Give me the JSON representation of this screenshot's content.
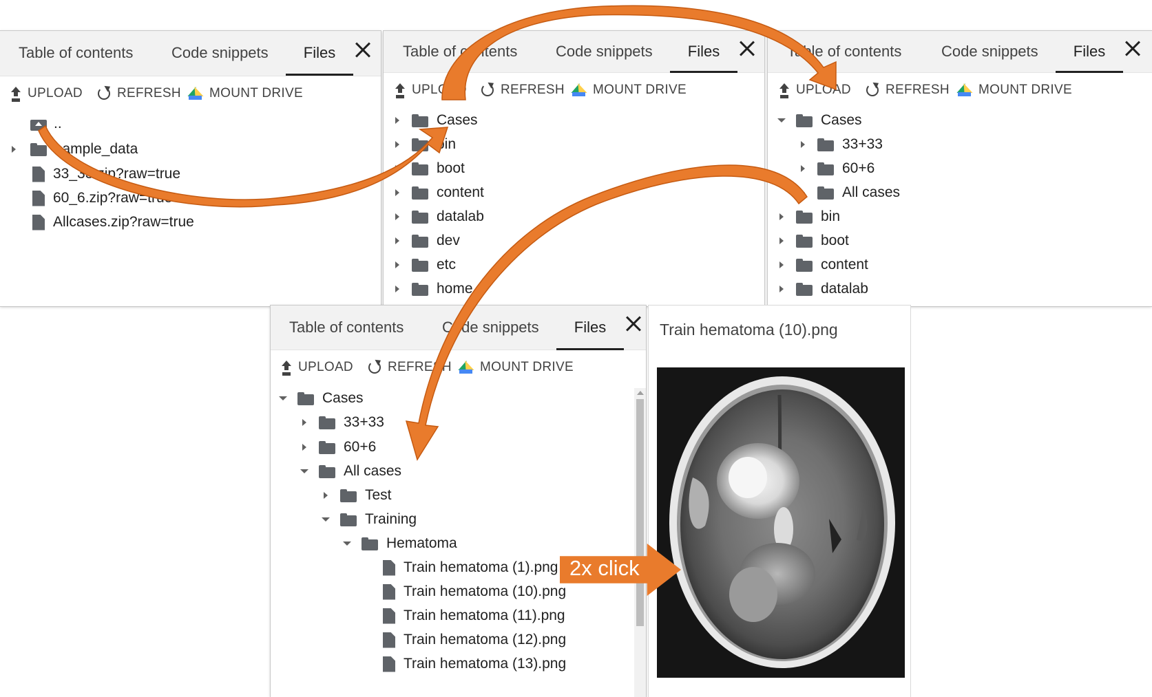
{
  "tabs": {
    "toc": "Table of contents",
    "snippets": "Code snippets",
    "files": "Files"
  },
  "toolbar": {
    "upload": "UPLOAD",
    "refresh": "REFRESH",
    "mount": "MOUNT DRIVE"
  },
  "panel1": {
    "parent": "..",
    "items": [
      "sample_data",
      "33_33.zip?raw=true",
      "60_6.zip?raw=true",
      "Allcases.zip?raw=true"
    ]
  },
  "panel2": {
    "items": [
      "Cases",
      "bin",
      "boot",
      "content",
      "datalab",
      "dev",
      "etc",
      "home"
    ]
  },
  "panel3": {
    "items": [
      "Cases",
      "33+33",
      "60+6",
      "All cases",
      "bin",
      "boot",
      "content",
      "datalab"
    ]
  },
  "panel4": {
    "items": [
      "Cases",
      "33+33",
      "60+6",
      "All cases",
      "Test",
      "Training",
      "Hematoma",
      "Train hematoma (1).png",
      "Train hematoma (10).png",
      "Train hematoma (11).png",
      "Train hematoma (12).png",
      "Train hematoma (13).png"
    ]
  },
  "viewer": {
    "title": "Train hematoma (10).png"
  },
  "callout": {
    "text": "2x click"
  },
  "colors": {
    "arrow": "#e97b2c",
    "arrow_edge": "#c55a11",
    "tab_bar": "#f2f2f2"
  }
}
